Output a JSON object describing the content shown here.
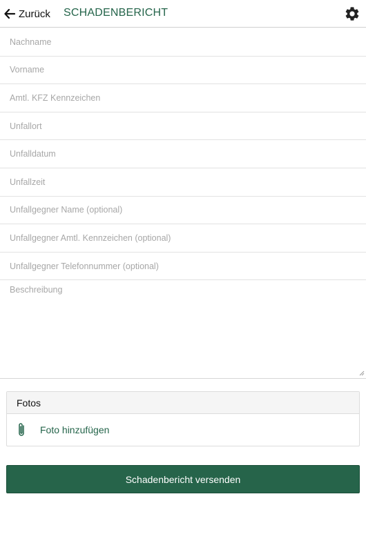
{
  "header": {
    "back_label": "Zurück",
    "title": "SCHADENBERICHT"
  },
  "form": {
    "fields": [
      {
        "placeholder": "Nachname",
        "value": ""
      },
      {
        "placeholder": "Vorname",
        "value": ""
      },
      {
        "placeholder": "Amtl. KFZ Kennzeichen",
        "value": ""
      },
      {
        "placeholder": "Unfallort",
        "value": ""
      },
      {
        "placeholder": "Unfalldatum",
        "value": ""
      },
      {
        "placeholder": "Unfallzeit",
        "value": ""
      },
      {
        "placeholder": "Unfallgegner Name (optional)",
        "value": ""
      },
      {
        "placeholder": "Unfallgegner Amtl. Kennzeichen (optional)",
        "value": ""
      },
      {
        "placeholder": "Unfallgegner Telefonnummer (optional)",
        "value": ""
      }
    ],
    "description": {
      "placeholder": "Beschreibung",
      "value": ""
    }
  },
  "photos": {
    "heading": "Fotos",
    "add_label": "Foto hinzufügen"
  },
  "submit_label": "Schadenbericht versenden",
  "icons": {
    "back": "arrow-left-icon",
    "settings": "gear-icon",
    "attach": "paperclip-icon"
  },
  "colors": {
    "accent": "#24644a",
    "button_bg": "#26644a",
    "placeholder": "#a7a7a7"
  }
}
